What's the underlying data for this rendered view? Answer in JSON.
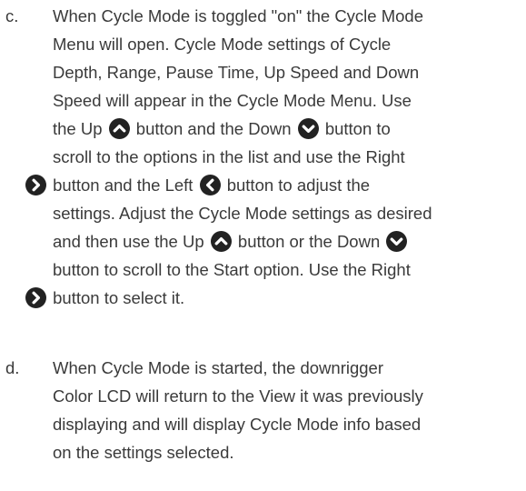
{
  "icons": {
    "up": "up-chevron-icon",
    "down": "down-chevron-icon",
    "right": "right-chevron-icon",
    "left": "left-chevron-icon",
    "color": "#222222"
  },
  "item_c": {
    "marker": "c.",
    "l1": "When Cycle Mode is toggled \"on\" the Cycle Mode",
    "l2": "Menu will open. Cycle Mode settings of Cycle",
    "l3": "Depth, Range, Pause Time, Up Speed and Down",
    "l4": "Speed will appear in the Cycle Mode Menu. Use",
    "l5a": "the Up",
    "l5b": "button and the Down",
    "l5c": "button to",
    "l6": "scroll to the options in the list and use the Right",
    "l7a": "button and the Left",
    "l7b": "button to adjust the",
    "l8": "settings. Adjust the Cycle Mode settings as desired",
    "l9a": "and then use the Up",
    "l9b": "button or the Down",
    "l10": "button to scroll to the Start option. Use the Right",
    "l11": "button to select it."
  },
  "item_d": {
    "marker": "d.",
    "l1": "When Cycle Mode is started, the downrigger",
    "l2": "Color LCD will return to the View it was previously",
    "l3": "displaying and will display Cycle Mode info based",
    "l4": "on the settings selected."
  }
}
